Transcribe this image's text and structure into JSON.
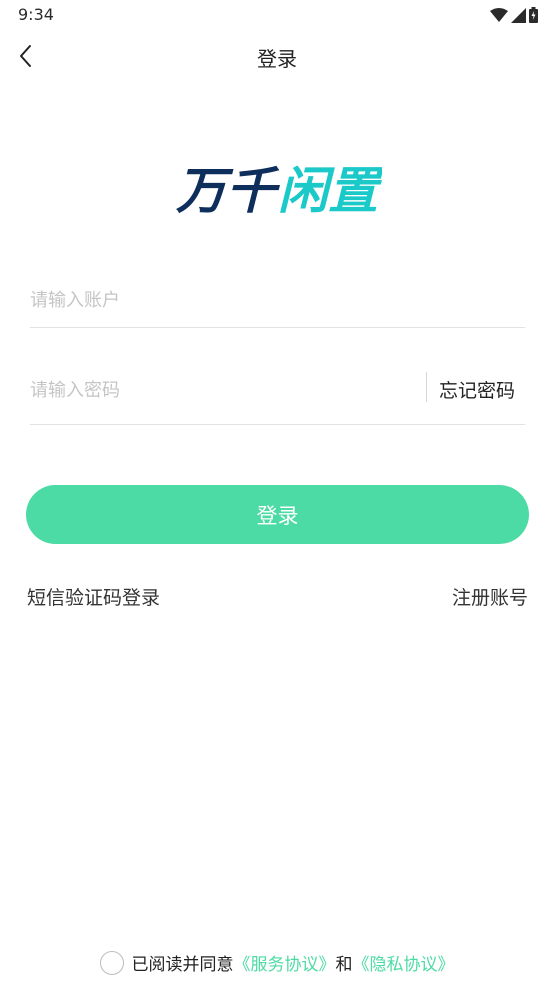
{
  "status_bar": {
    "time": "9:34",
    "icons": [
      "wifi-icon",
      "signal-icon",
      "battery-charging-icon"
    ]
  },
  "nav": {
    "title": "登录",
    "back_icon": "chevron-left-icon"
  },
  "logo": {
    "part1": "万千",
    "part2": "闲置",
    "colors": {
      "dark": "#0e2f5c",
      "accent": "#1cc9c9"
    }
  },
  "form": {
    "account_placeholder": "请输入账户",
    "password_placeholder": "请输入密码",
    "forgot_password_label": "忘记密码",
    "login_label": "登录"
  },
  "links": {
    "sms_login": "短信验证码登录",
    "register": "注册账号"
  },
  "agreement": {
    "prefix": "已阅读并同意",
    "service": "《服务协议》",
    "conjunction": "和",
    "privacy": "《隐私协议》",
    "checked": false
  },
  "colors": {
    "accent": "#4cdba4",
    "text": "#222222",
    "placeholder": "#c5c5c5",
    "divider": "#e3e3e3"
  }
}
